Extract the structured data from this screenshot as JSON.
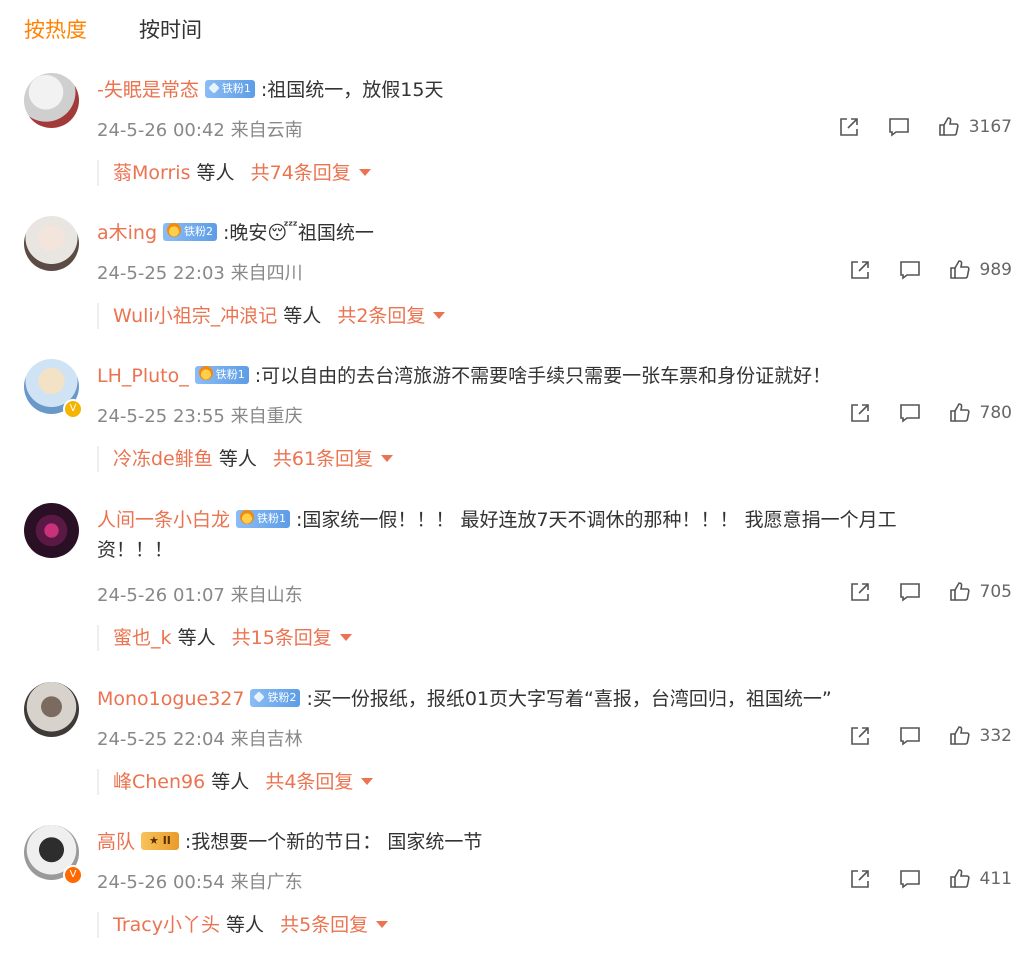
{
  "tabs": {
    "hot": "按热度",
    "time": "按时间"
  },
  "comments": [
    {
      "user": "-失眠是常态",
      "badge": "铁粉1",
      "text": ":祖国统一，放假15天",
      "text_cont": "",
      "date": "24-5-26 00:42 来自云南",
      "likes": "3167",
      "reply_user": "蓊Morris",
      "reply_etc": "等人",
      "reply_count": "共74条回复",
      "avatar_colors": [
        "#cfcfcf",
        "#a33a3a"
      ]
    },
    {
      "user": "a木ing",
      "badge": "铁粉2",
      "text": ":晚安😴祖国统一",
      "text_cont": "",
      "date": "24-5-25 22:03 来自四川",
      "likes": "989",
      "reply_user": "Wuli小祖宗_冲浪记",
      "reply_etc": "等人",
      "reply_count": "共2条回复",
      "avatar_colors": [
        "#e9e6e2",
        "#5a4b44"
      ]
    },
    {
      "user": "LH_Pluto_",
      "badge": "铁粉1",
      "text": ":可以自由的去台湾旅游不需要啥手续只需要一张车票和身份证就好！",
      "text_cont": "",
      "date": "24-5-25 23:55 来自重庆",
      "likes": "780",
      "reply_user": "冷冻de鲱鱼",
      "reply_etc": "等人",
      "reply_count": "共61条回复",
      "avatar_colors": [
        "#cfe3f5",
        "#6a98c9"
      ]
    },
    {
      "user": "人间一条小白龙",
      "badge": "铁粉1",
      "text": ":国家统一假！！！ 最好连放7天不调休的那种！！！ 我愿意捐一个月工",
      "text_cont": "资！！！",
      "date": "24-5-26 01:07 来自山东",
      "likes": "705",
      "reply_user": "蜜也_k",
      "reply_etc": "等人",
      "reply_count": "共15条回复",
      "avatar_colors": [
        "#2a1024",
        "#c9317a"
      ]
    },
    {
      "user": "Mono1ogue327",
      "badge": "铁粉2",
      "text": ":买一份报纸，报纸01页大字写着“喜报，台湾回归，祖国统一”",
      "text_cont": "",
      "date": "24-5-25 22:04 来自吉林",
      "likes": "332",
      "reply_user": "峰Chen96",
      "reply_etc": "等人",
      "reply_count": "共4条回复",
      "avatar_colors": [
        "#d7d2cc",
        "#3e3a38"
      ]
    },
    {
      "user": "高队",
      "badge": "II",
      "text": ":我想要一个新的节日： 国家统一节",
      "text_cont": "",
      "date": "24-5-26 00:54 来自广东",
      "likes": "411",
      "reply_user": "Tracy小丫头",
      "reply_etc": "等人",
      "reply_count": "共5条回复",
      "avatar_colors": [
        "#efefef",
        "#2d2d2d"
      ]
    }
  ],
  "colors": {
    "accent": "#ff8200",
    "username": "#eb7350",
    "meta": "#888888"
  }
}
